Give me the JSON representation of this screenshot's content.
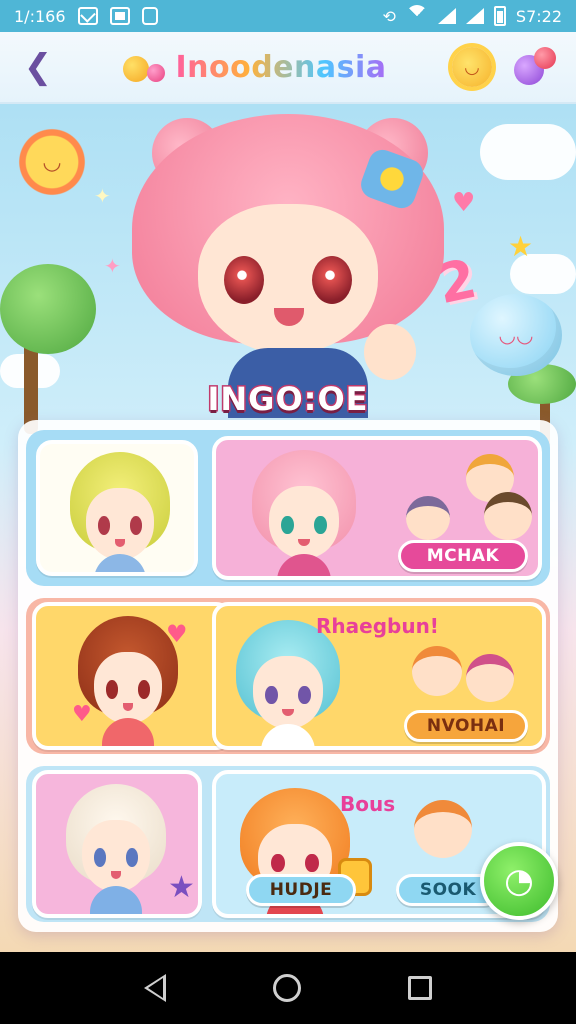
{
  "status_bar": {
    "time_left": "1/:166",
    "clock": "S7:22",
    "icons": [
      "mail-icon",
      "box-icon",
      "shield-icon",
      "vibrate-icon",
      "wifi-icon",
      "signal-icon",
      "signal-icon",
      "battery-icon"
    ]
  },
  "header": {
    "title": "Inoodenasia",
    "back_icon": "arrow-left-icon",
    "right_icons": [
      "sun-smiley-icon",
      "balloons-icon"
    ]
  },
  "hero": {
    "label": "INGO:OE",
    "decor_number": "2"
  },
  "cards": {
    "row1": {
      "right_label": "MCHAK"
    },
    "row2": {
      "right_title": "Rhaegbun!",
      "right_label": "NVOHAI"
    },
    "row3": {
      "right_title": "Bous",
      "left_pill": "HUDJE",
      "right_pill": "SOOK"
    }
  },
  "fab": {
    "icon": "chat-bubble-icon"
  },
  "nav": {
    "items": [
      "back",
      "home",
      "recents"
    ]
  },
  "colors": {
    "status_bar": "#4fb6d6",
    "accent_pink": "#e8409a",
    "fab_green": "#3dbb2c"
  }
}
